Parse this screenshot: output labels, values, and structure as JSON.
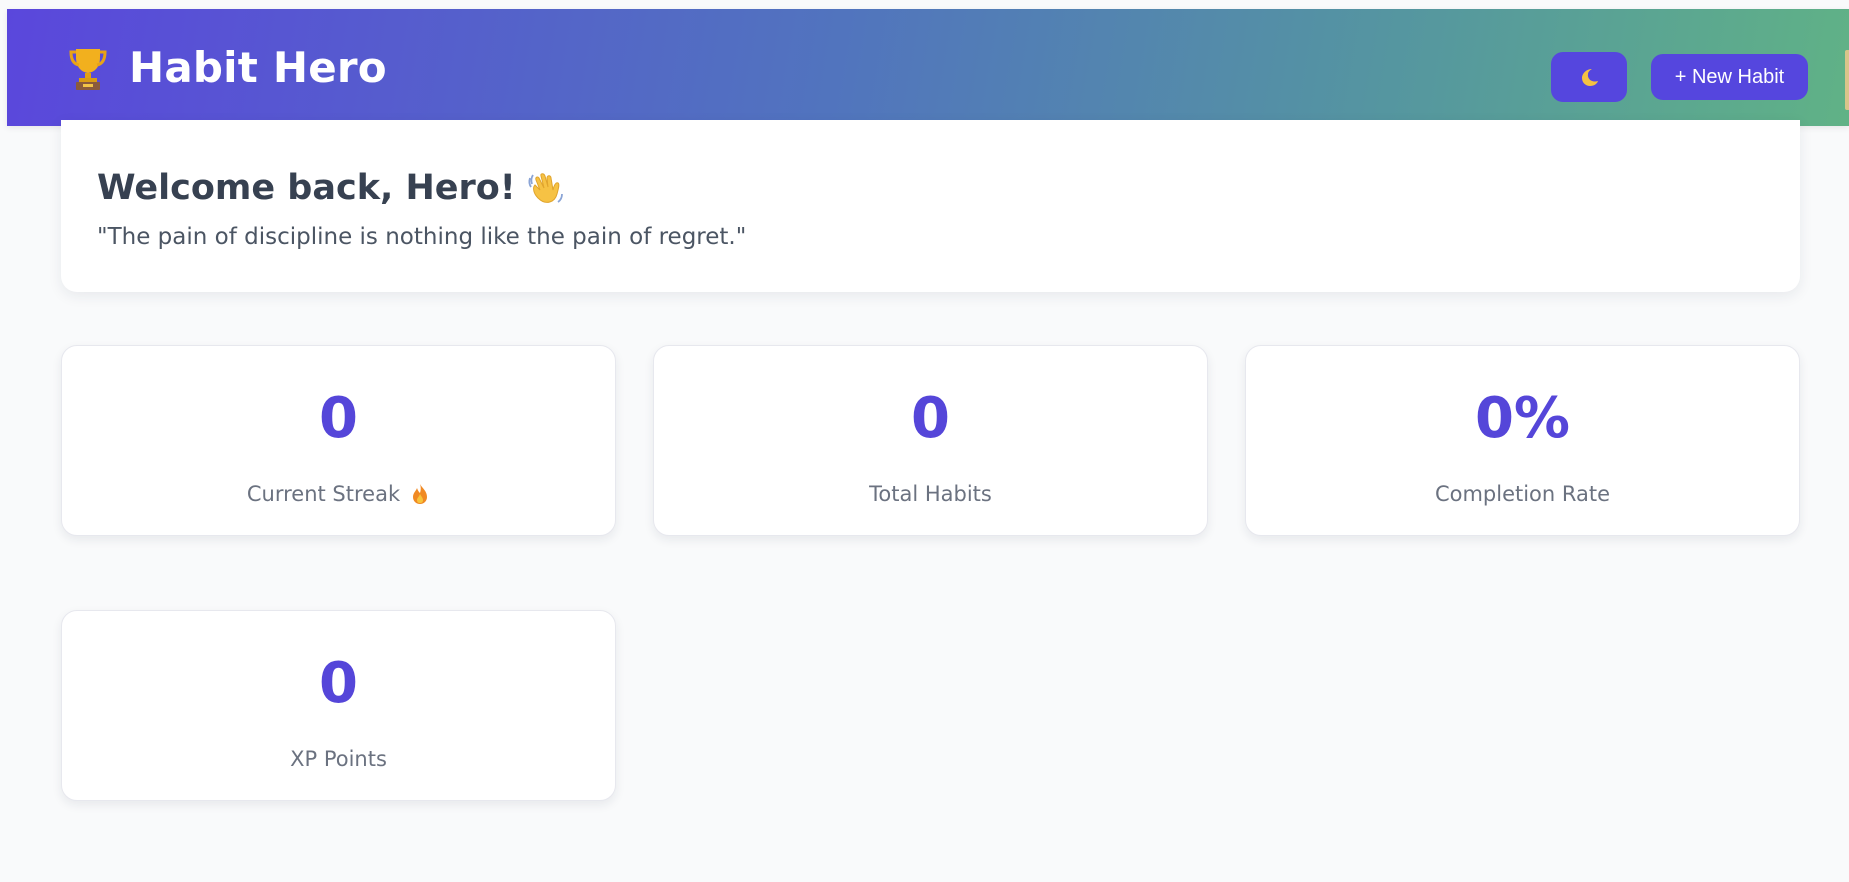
{
  "header": {
    "title": "Habit Hero",
    "logo_icon": "trophy-icon",
    "theme_toggle_icon": "moon-icon",
    "new_habit_label": "+ New Habit",
    "gradient_colors": [
      "#5a47dc",
      "#60b286"
    ],
    "button_color": "#5546de"
  },
  "welcome": {
    "title": "Welcome back, Hero!",
    "title_icon": "waving-hand-icon",
    "quote": "\"The pain of discipline is nothing like the pain of regret.\""
  },
  "stats": [
    {
      "value": "0",
      "label": "Current Streak",
      "icon": "fire-icon"
    },
    {
      "value": "0",
      "label": "Total Habits"
    },
    {
      "value": "0%",
      "label": "Completion Rate"
    },
    {
      "value": "0",
      "label": "XP Points"
    }
  ],
  "colors": {
    "stat_value": "#5546d9",
    "background": "#f9fafb"
  }
}
